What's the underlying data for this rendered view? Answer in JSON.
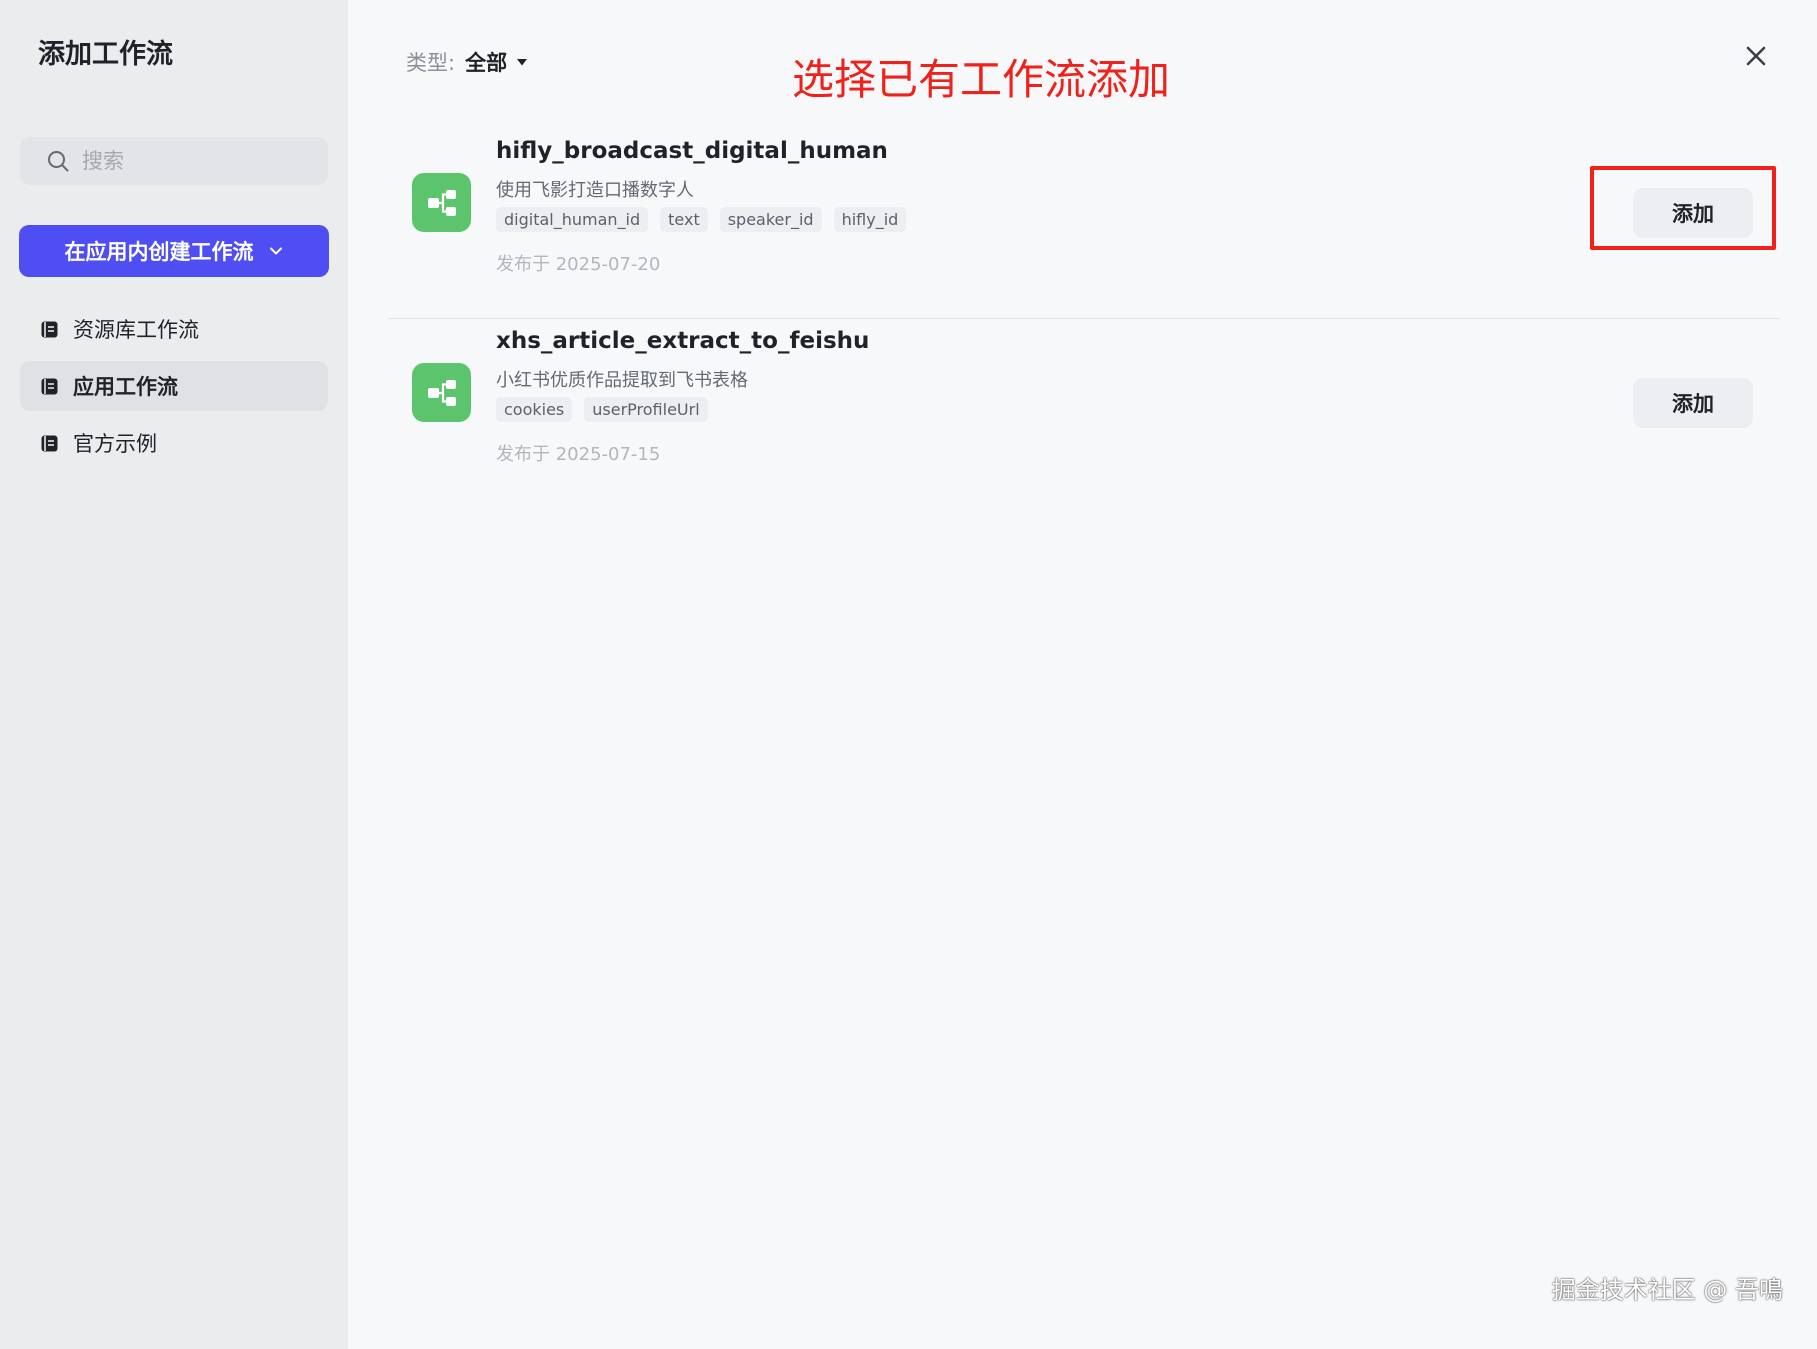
{
  "sidebar": {
    "title": "添加工作流",
    "search_placeholder": "搜索",
    "create_button": "在应用内创建工作流",
    "nav": [
      {
        "label": "资源库工作流",
        "active": false
      },
      {
        "label": "应用工作流",
        "active": true
      },
      {
        "label": "官方示例",
        "active": false
      }
    ]
  },
  "main": {
    "filter_label": "类型:",
    "filter_value": "全部",
    "annotation": "选择已有工作流添加",
    "workflows": [
      {
        "name": "hifly_broadcast_digital_human",
        "description": "使用飞影打造口播数字人",
        "tags": [
          "digital_human_id",
          "text",
          "speaker_id",
          "hifly_id"
        ],
        "date": "发布于 2025-07-20",
        "add_label": "添加"
      },
      {
        "name": "xhs_article_extract_to_feishu",
        "description": "小红书优质作品提取到飞书表格",
        "tags": [
          "cookies",
          "userProfileUrl"
        ],
        "date": "发布于 2025-07-15",
        "add_label": "添加"
      }
    ]
  },
  "watermark": "掘金技术社区 @ 吾鳴",
  "colors": {
    "primary": "#4e4ef2",
    "workflow_icon": "#5cc46c",
    "annotation": "#f0211b",
    "sidebar_bg": "#ebecee",
    "main_bg": "#f7f8fa"
  },
  "icons": {
    "search": "search-icon",
    "create_chevron": "chevron-down-icon",
    "nav": "library-icon",
    "filter_caret": "caret-down-icon",
    "close": "close-icon",
    "workflow": "workflow-icon"
  }
}
